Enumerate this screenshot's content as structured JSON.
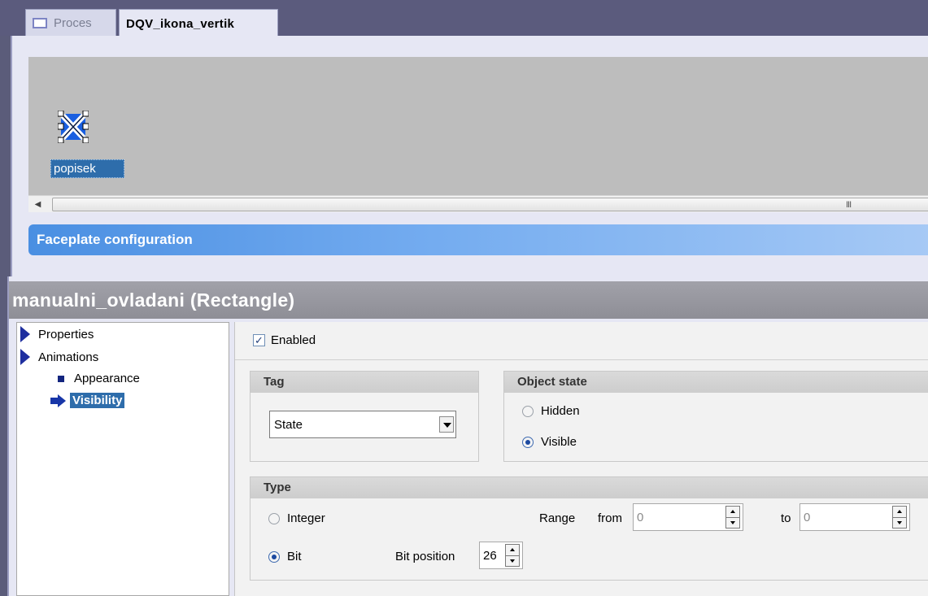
{
  "tabs": [
    {
      "label": "Proces",
      "active": false
    },
    {
      "label": "DQV_ikona_vertik",
      "active": true
    }
  ],
  "canvas": {
    "object_label": "popisek",
    "scroll_grip": "III"
  },
  "faceplate_bar": {
    "title": "Faceplate configuration"
  },
  "inspector": {
    "title": "manualni_ovladani (Rectangle)",
    "tree": {
      "properties": "Properties",
      "animations": "Animations",
      "appearance": "Appearance",
      "visibility": "Visibility"
    },
    "enabled": {
      "label": "Enabled",
      "checked": true
    },
    "tag_group": {
      "header": "Tag",
      "value": "State"
    },
    "state_group": {
      "header": "Object state",
      "options": [
        "Hidden",
        "Visible"
      ],
      "selected": "Visible"
    },
    "type_group": {
      "header": "Type",
      "integer_label": "Integer",
      "bit_label": "Bit",
      "selected": "Bit",
      "range_label": "Range",
      "from_label": "from",
      "from_value": "0",
      "to_label": "to",
      "to_value": "0",
      "bit_position_label": "Bit position",
      "bit_position_value": "26"
    }
  },
  "colors": {
    "window_frame": "#5b5b7d",
    "canvas_bg": "#bdbdbd",
    "faceplate_gradient_start": "#4a8fe2",
    "selection_blue": "#2e6dab",
    "tree_arrow": "#1f2f9f"
  },
  "icons": {
    "tab_proces": "window-icon",
    "object": "faceplate-object-icon",
    "tree_expand": "triangle-right-icon",
    "tree_bullet": "square-bullet-icon",
    "tree_selected": "blue-arrow-icon",
    "dropdown": "chevron-down-icon",
    "spin": "spin-updown-icon"
  }
}
